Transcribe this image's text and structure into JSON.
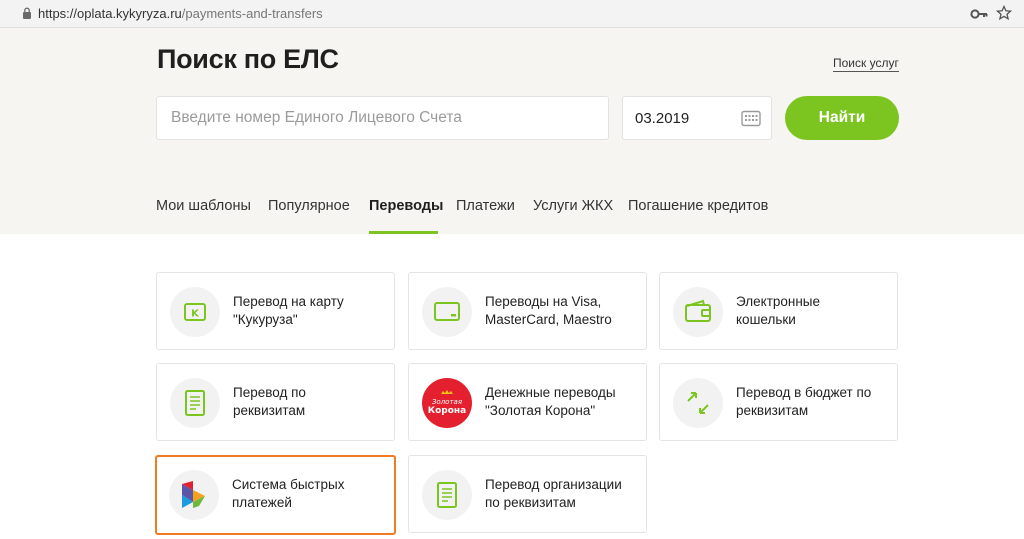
{
  "browser": {
    "url_host": "https://oplata.kykyryza.ru",
    "url_path": "/payments-and-transfers"
  },
  "header": {
    "title": "Поиск по ЕЛС",
    "service_link": "Поиск услуг"
  },
  "search": {
    "placeholder": "Введите номер Единого Лицевого Счета",
    "date_value": "03.2019",
    "find_label": "Найти"
  },
  "tabs": [
    {
      "label": "Мои шаблоны",
      "active": false
    },
    {
      "label": "Популярное",
      "active": false
    },
    {
      "label": "Переводы",
      "active": true
    },
    {
      "label": "Платежи",
      "active": false
    },
    {
      "label": "Услуги ЖКХ",
      "active": false
    },
    {
      "label": "Погашение кредитов",
      "active": false
    }
  ],
  "cards": [
    {
      "line1": "Перевод на карту",
      "line2": "\"Кукуруза\"",
      "icon": "card-k-icon"
    },
    {
      "line1": "Переводы на Visa,",
      "line2": "MasterCard, Maestro",
      "icon": "bank-card-icon"
    },
    {
      "line1": "Электронные",
      "line2": "кошельки",
      "icon": "wallet-icon"
    },
    {
      "line1": "Перевод по",
      "line2": "реквизитам",
      "icon": "document-icon"
    },
    {
      "line1": "Денежные переводы",
      "line2": "\"Золотая Корона\"",
      "icon": "zolotaya-korona-logo",
      "logo_line1": "Золотая",
      "logo_line2": "Корона"
    },
    {
      "line1": "Перевод в бюджет по",
      "line2": "реквизитам",
      "icon": "arrows-diagonal-icon"
    },
    {
      "line1": "Система быстрых",
      "line2": "платежей",
      "icon": "sbp-logo"
    },
    {
      "line1": "Перевод организации",
      "line2": "по реквизитам",
      "icon": "document-icon"
    }
  ],
  "colors": {
    "accent_green": "#7cc521",
    "highlight_orange": "#f07b22",
    "hero_bg": "#f6f5f1",
    "korona_red": "#e5202e"
  }
}
